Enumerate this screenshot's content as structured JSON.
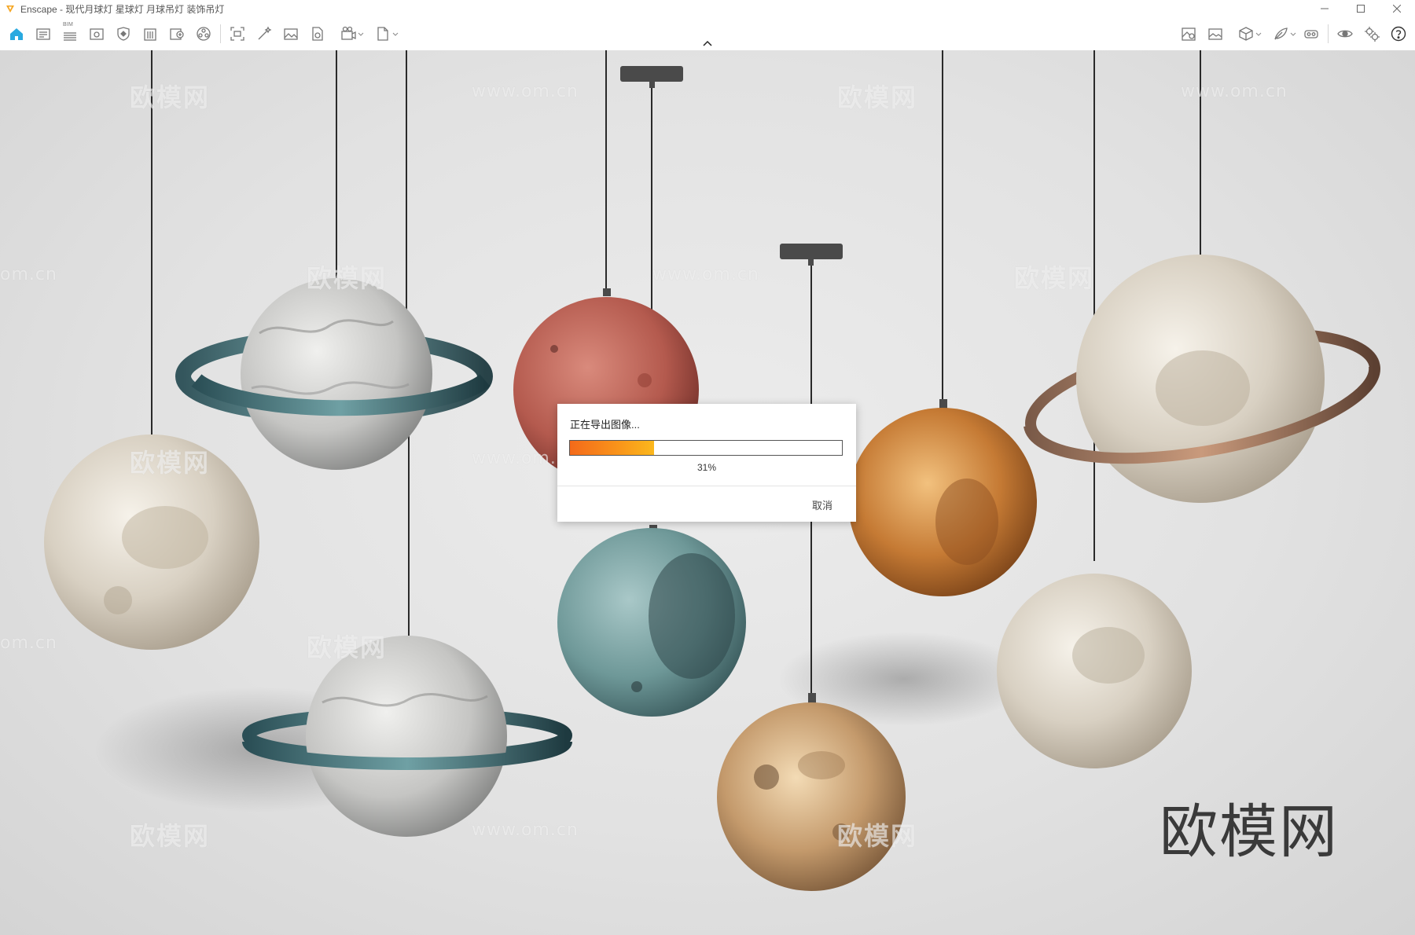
{
  "window": {
    "app_name": "Enscape",
    "title": "Enscape - 现代月球灯 星球灯 月球吊灯 装饰吊灯",
    "accent_color": "#f5a623"
  },
  "toolbar": {
    "left_icons": [
      "home-icon",
      "scene-icon",
      "bim-icon",
      "views-icon",
      "asset-icon",
      "building-icon",
      "export-icon",
      "materials-icon",
      "screenshot-icon",
      "magic-icon",
      "image-icon",
      "batch-icon",
      "video-icon",
      "file-icon"
    ],
    "bim_label": "BIM",
    "right_icons": [
      "map-icon",
      "gallery-icon",
      "cube-icon",
      "feather-icon",
      "vr-icon",
      "eye-icon",
      "settings-icon",
      "help-icon"
    ]
  },
  "viewport": {
    "watermark_brand": "欧模网",
    "watermark_url": "www.om.cn",
    "watermark_url_fragment": "om.cn",
    "logo_watermark": "欧模网"
  },
  "dialog": {
    "message": "正在导出图像...",
    "progress": 0.31,
    "progress_label": "31%",
    "cancel_label": "取消",
    "progress_colors": [
      "#f46a1a",
      "#fbb81c"
    ]
  }
}
